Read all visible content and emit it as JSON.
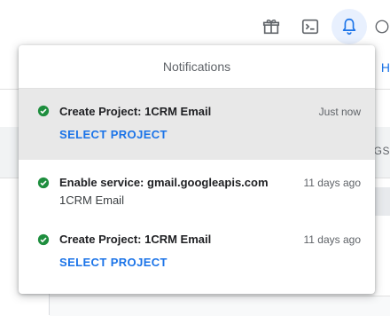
{
  "background": {
    "right_blue_text": "H",
    "right_header_text": "AGS",
    "icons": [
      "gift-icon",
      "cloud-shell-icon",
      "bell-icon",
      "help-icon"
    ]
  },
  "popup": {
    "title": "Notifications",
    "items": [
      {
        "title": "Create Project: 1CRM Email",
        "time": "Just now",
        "action": "SELECT PROJECT",
        "status": "success",
        "highlighted": true
      },
      {
        "title": "Enable service: gmail.googleapis.com",
        "time": "11 days ago",
        "subtitle": "1CRM Email",
        "status": "success",
        "highlighted": false
      },
      {
        "title": "Create Project: 1CRM Email",
        "time": "11 days ago",
        "action": "SELECT PROJECT",
        "status": "success",
        "highlighted": false
      }
    ]
  },
  "colors": {
    "accent": "#1a73e8",
    "success": "#1e8e3e",
    "highlight_bg": "#e8e8e8"
  }
}
